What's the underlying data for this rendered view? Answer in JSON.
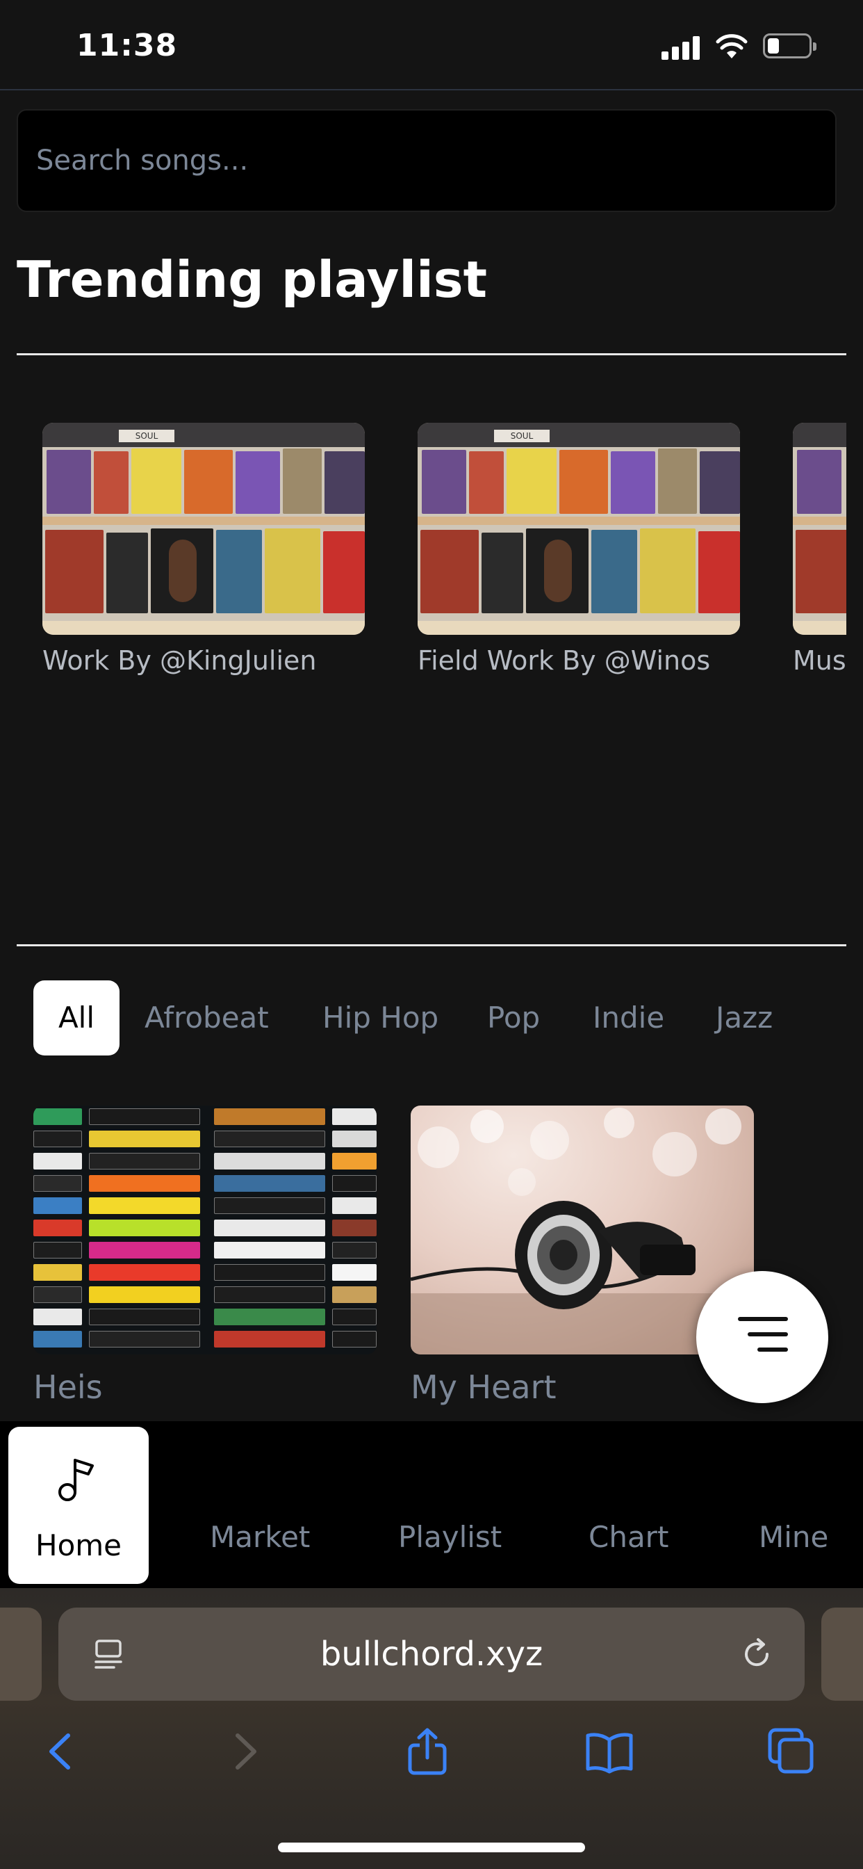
{
  "status_bar": {
    "time": "11:38"
  },
  "search": {
    "placeholder": "Search songs..."
  },
  "trending": {
    "title": "Trending playlist",
    "playlists": [
      {
        "name": "Work By @KingJulien"
      },
      {
        "name": "Field Work By @Winos"
      },
      {
        "name": "Mus"
      }
    ]
  },
  "genres": [
    "All",
    "Afrobeat",
    "Hip Hop",
    "Pop",
    "Indie",
    "Jazz"
  ],
  "songs": [
    {
      "title": "Heis",
      "image": "cassette-tapes"
    },
    {
      "title": "My Heart",
      "image": "headphones"
    }
  ],
  "fab": {
    "icon": "sort-icon"
  },
  "bottom_nav": {
    "home": "Home",
    "market": "Market",
    "playlist": "Playlist",
    "chart": "Chart",
    "mine": "Mine"
  },
  "browser": {
    "url": "bullchord.xyz"
  },
  "colors": {
    "accent": "#3b82f6",
    "muted_text": "#7c8797",
    "background": "#141414"
  }
}
